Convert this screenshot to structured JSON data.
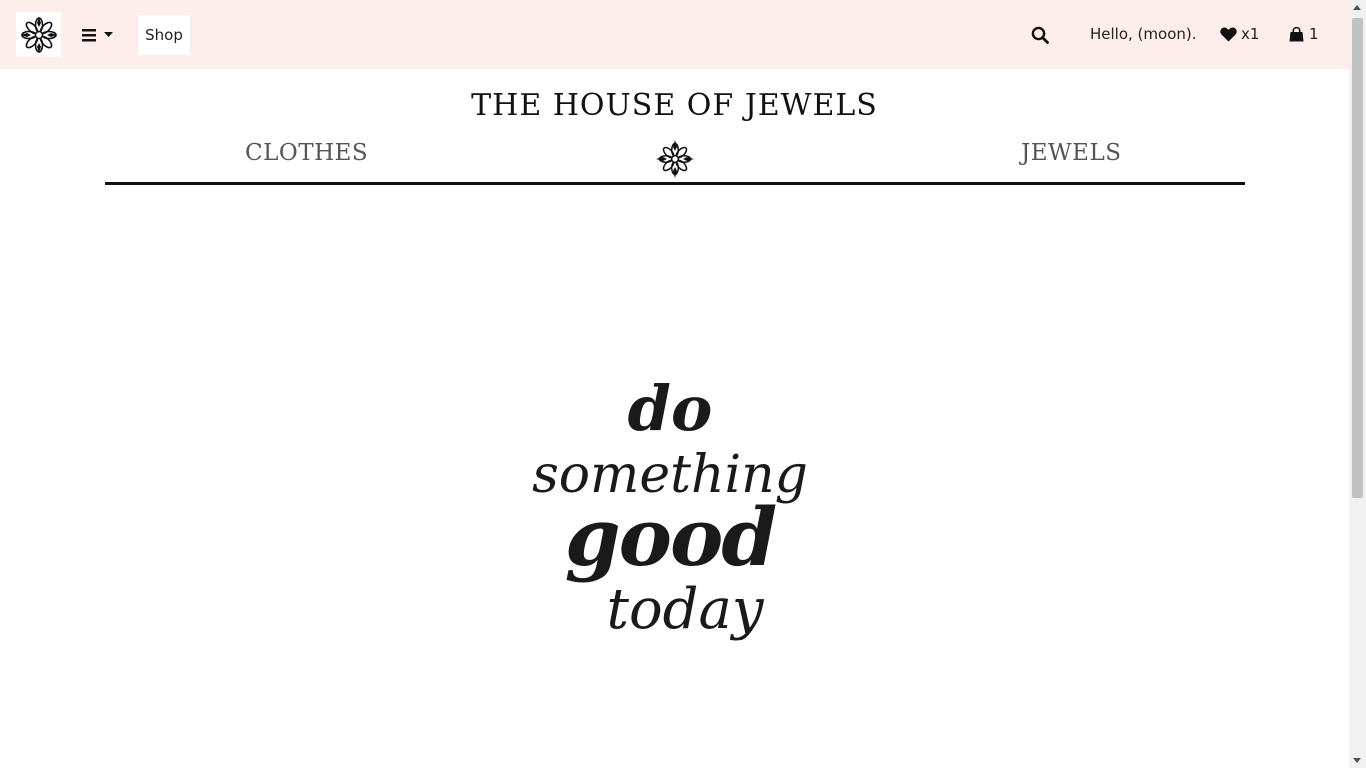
{
  "topbar": {
    "logo_icon": "mandala-flower-icon",
    "menu_icon": "bars-icon",
    "shop_label": "Shop",
    "search_icon": "search-icon",
    "greeting": "Hello, (moon).",
    "wishlist": {
      "icon": "heart-icon",
      "count": "x1"
    },
    "cart": {
      "icon": "shopping-bag-icon",
      "count": "1"
    },
    "background": "#fdeeec"
  },
  "header": {
    "title": "THE HOUSE OF JEWELS",
    "nav": {
      "left": "CLOTHES",
      "center_icon": "mandala-flower-icon",
      "right": "JEWELS"
    }
  },
  "hero": {
    "lines": [
      "do",
      "something",
      "good",
      "today"
    ]
  }
}
